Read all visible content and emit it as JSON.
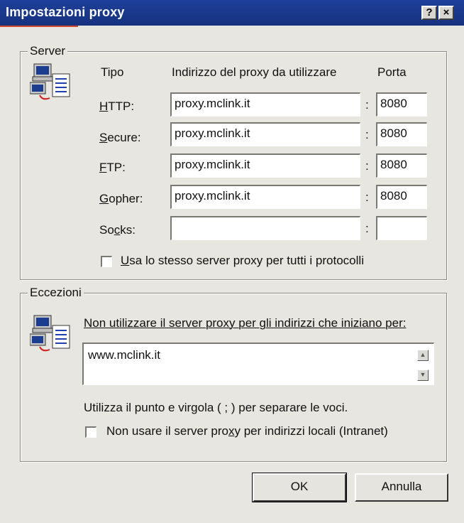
{
  "window": {
    "title": "Impostazioni proxy",
    "help_label": "?",
    "close_label": "×"
  },
  "server": {
    "group_label": "Server",
    "col_type": "Tipo",
    "col_address": "Indirizzo del proxy da utilizzare",
    "col_port": "Porta",
    "rows": [
      {
        "label": "HTTP:",
        "address": "proxy.mclink.it",
        "port": "8080"
      },
      {
        "label": "Secure:",
        "address": "proxy.mclink.it",
        "port": "8080"
      },
      {
        "label": "FTP:",
        "address": "proxy.mclink.it",
        "port": "8080"
      },
      {
        "label": "Gopher:",
        "address": "proxy.mclink.it",
        "port": "8080"
      },
      {
        "label": "Socks:",
        "address": "",
        "port": ""
      }
    ],
    "same_server_label": "Usa lo stesso server proxy per tutti i protocolli",
    "same_server_checked": false
  },
  "exceptions": {
    "group_label": "Eccezioni",
    "instruction": "Non utilizzare il server proxy per gli indirizzi che iniziano per:",
    "value": "www.mclink.it",
    "hint": "Utilizza il punto e virgola ( ; ) per separare le voci.",
    "local_label": "Non usare il server proxy per indirizzi locali (Intranet)",
    "local_checked": false
  },
  "buttons": {
    "ok": "OK",
    "cancel": "Annulla"
  }
}
